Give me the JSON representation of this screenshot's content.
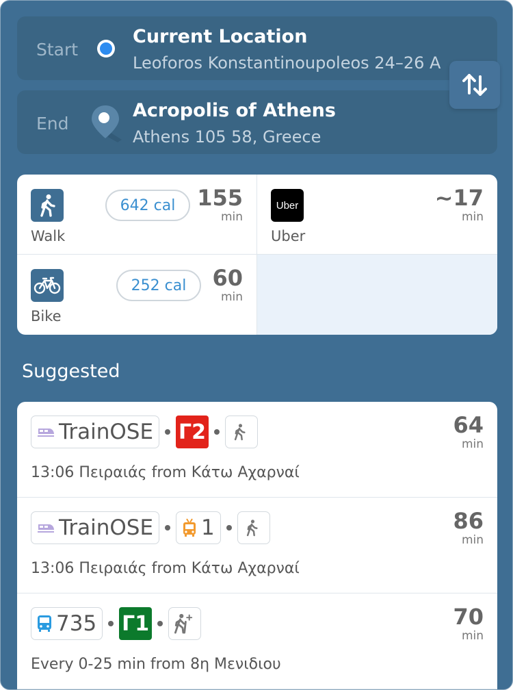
{
  "locations": {
    "start": {
      "label": "Start",
      "title": "Current Location",
      "subtitle": "Leoforos Konstantinoupoleos 24–26 A"
    },
    "end": {
      "label": "End",
      "title": "Acropolis of Athens",
      "subtitle": "Athens 105 58, Greece"
    }
  },
  "modes": {
    "walk": {
      "name": "Walk",
      "calories": "642 cal",
      "time": "155",
      "unit": "min",
      "icon": "walk-icon"
    },
    "uber": {
      "name": "Uber",
      "logo": "Uber",
      "time": "~17",
      "unit": "min"
    },
    "bike": {
      "name": "Bike",
      "calories": "252 cal",
      "time": "60",
      "unit": "min",
      "icon": "bike-icon"
    }
  },
  "suggested_heading": "Suggested",
  "routes": [
    {
      "first": {
        "icon": "train-icon",
        "label": "TrainOSE"
      },
      "line": {
        "label": "Γ2",
        "color": "#e2231a",
        "type": "badge"
      },
      "time": "64",
      "unit": "min",
      "details": "13:06 Πειραιάς from Κάτω Αχαρναί"
    },
    {
      "first": {
        "icon": "train-icon",
        "label": "TrainOSE"
      },
      "line": {
        "label": "1",
        "icon": "trolleybus-icon",
        "type": "chip"
      },
      "time": "86",
      "unit": "min",
      "details": "13:06 Πειραιάς from Κάτω Αχαρναί"
    },
    {
      "first": {
        "icon": "bus-icon",
        "label": "735"
      },
      "line": {
        "label": "Γ1",
        "color": "#0c7a2c",
        "type": "badge"
      },
      "time": "70",
      "unit": "min",
      "details": "Every 0-25 min from 8η Μενιδιου"
    }
  ],
  "colors": {
    "background": "#3f6e93",
    "accent_blue": "#2d8cf0",
    "calorie_text": "#3a8fd0"
  }
}
